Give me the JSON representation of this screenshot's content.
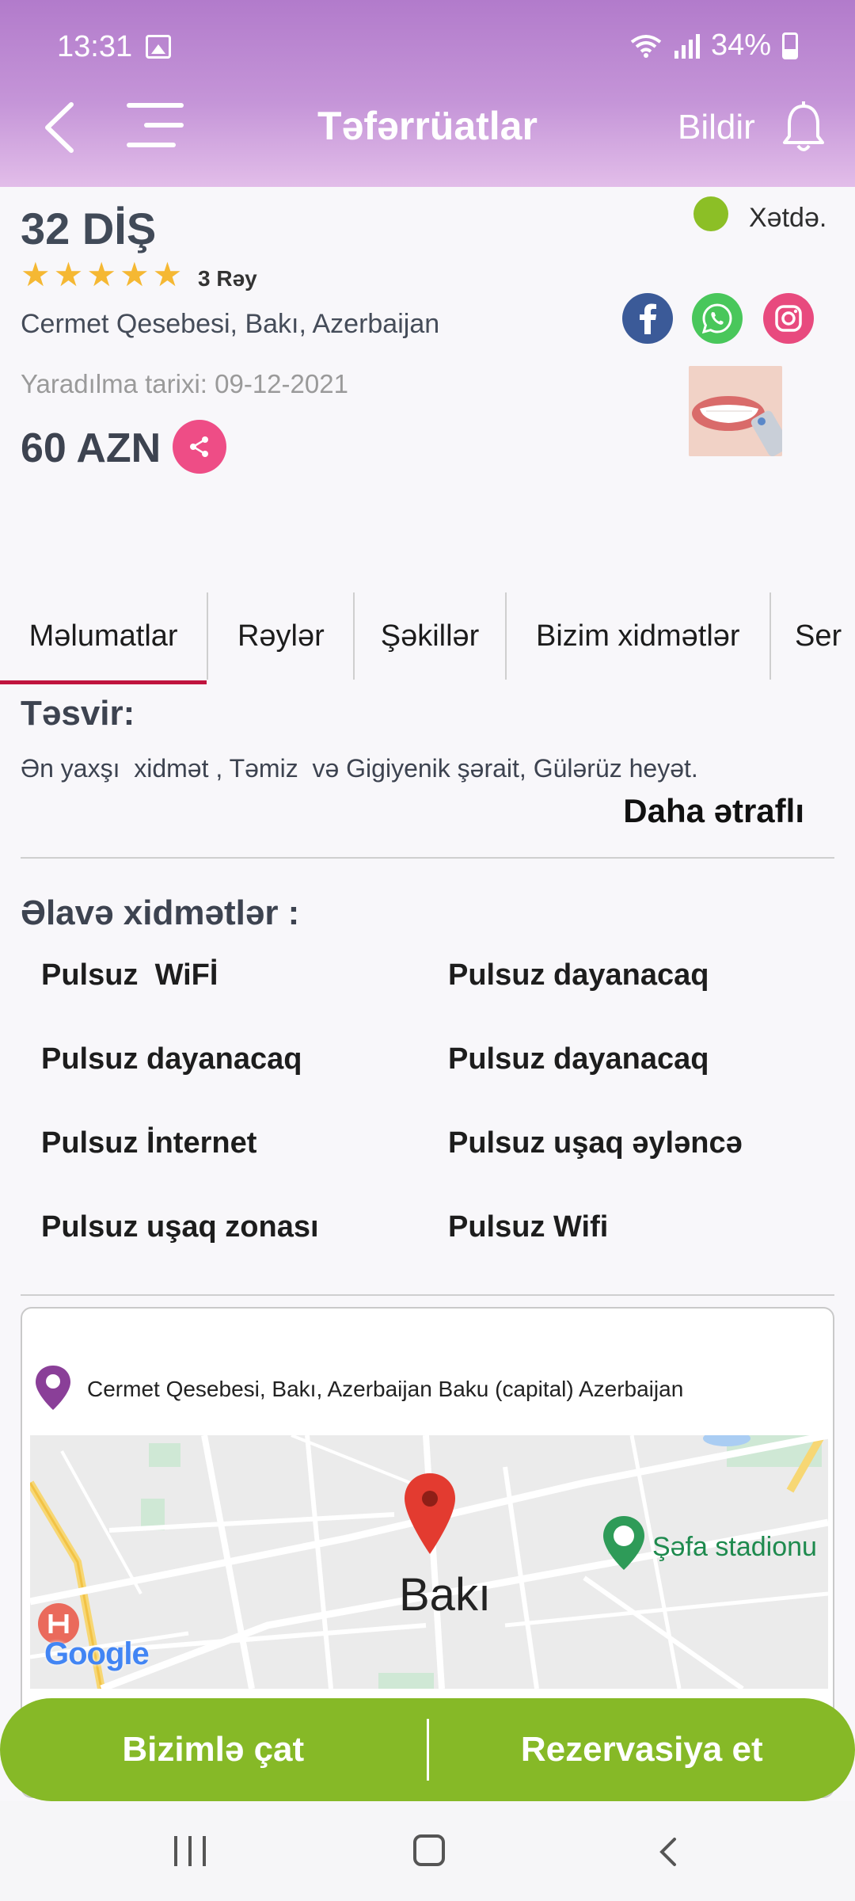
{
  "status_bar": {
    "time": "13:31",
    "battery": "34%"
  },
  "header": {
    "title": "Təfərrüatlar",
    "report_label": "Bildir"
  },
  "listing": {
    "title": "32 DİŞ",
    "online_status": "Xətdə.",
    "rating": 5,
    "review_count": "3 Rəy",
    "address": "Cermet Qesebesi, Bakı, Azerbaijan",
    "created": "Yaradılma tarixi: 09-12-2021",
    "price": "60 AZN"
  },
  "tabs": [
    {
      "label": "Məlumatlar",
      "active": true
    },
    {
      "label": "Rəylər",
      "active": false
    },
    {
      "label": "Şəkillər",
      "active": false
    },
    {
      "label": "Bizim xidmətlər",
      "active": false
    },
    {
      "label": "Ser",
      "active": false
    }
  ],
  "description": {
    "heading": "Təsvir:",
    "text": "Ən yaxşı  xidmət , Təmiz  və Gigiyenik şərait, Gülərüz heyət.",
    "more_label": "Daha ətraflı"
  },
  "extras": {
    "heading": "Əlavə xidmətlər :",
    "items": [
      "Pulsuz  WiFİ",
      "Pulsuz dayanacaq",
      "Pulsuz dayanacaq",
      "Pulsuz dayanacaq",
      "Pulsuz İnternet",
      "Pulsuz uşaq əyləncə",
      "Pulsuz uşaq zonası",
      "Pulsuz Wifi"
    ]
  },
  "location": {
    "address": "Cermet Qesebesi, Bakı, Azerbaijan Baku (capital) Azerbaijan",
    "map_city": "Bakı",
    "map_poi": "Şəfa stadionu",
    "map_brand": "Google"
  },
  "actions": {
    "chat_label": "Bizimlə çat",
    "reserve_label": "Rezervasiya et"
  },
  "colors": {
    "header": "#b27bcb",
    "accent_green": "#86b927",
    "tab_indicator": "#c0143e",
    "share": "#ee4d86"
  }
}
